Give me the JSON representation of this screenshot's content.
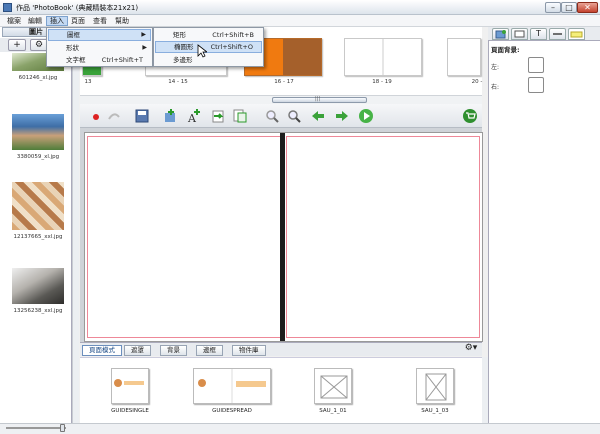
{
  "window": {
    "title": "作品 'PhotoBook' (典藏精裝本21x21)",
    "min_label": "–",
    "max_label": "□",
    "close_label": "✕"
  },
  "menubar": [
    "檔案",
    "編輯",
    "插入",
    "頁面",
    "查看",
    "幫助"
  ],
  "insert_menu": {
    "items": [
      {
        "label": "圖框",
        "shortcut": "",
        "submenu": true
      },
      {
        "label": "形狀",
        "shortcut": "",
        "submenu": true
      },
      {
        "label": "文字框",
        "shortcut": "Ctrl+Shift+T",
        "submenu": false
      }
    ]
  },
  "frame_submenu": {
    "items": [
      {
        "label": "矩形",
        "shortcut": "Ctrl+Shift+B"
      },
      {
        "label": "橢圓形",
        "shortcut": "Ctrl+Shift+O"
      },
      {
        "label": "多邊形",
        "shortcut": ""
      }
    ]
  },
  "left_panel": {
    "tab_label": "圖片",
    "add_label": "+",
    "gear_label": "⚙",
    "photos": [
      {
        "caption": "601246_xl.jpg",
        "color": "#7a8c5a"
      },
      {
        "caption": "3380059_xl.jpg",
        "color": "#3e6ea6"
      },
      {
        "caption": "12137665_xxl.jpg",
        "color": "#c98a55"
      },
      {
        "caption": "13256238_xxl.jpg",
        "color": "#6b6a66"
      }
    ]
  },
  "page_strip": {
    "pages": [
      {
        "caption": "13"
      },
      {
        "caption": "14 - 15"
      },
      {
        "caption": "16 - 17"
      },
      {
        "caption": "18 - 19"
      },
      {
        "caption": "20 -"
      }
    ],
    "scroll_grip": "|||"
  },
  "toolbar_icons": [
    "record-icon",
    "redo-icon",
    "save-icon",
    "add-image-icon",
    "add-text-icon",
    "export-icon",
    "export-copy-icon",
    "zoom-out-icon",
    "zoom-in-icon",
    "prev-icon",
    "next-icon",
    "play-icon",
    "cart-icon"
  ],
  "bottom_tabs": [
    "頁面模式",
    "遮罩",
    "背景",
    "邊框",
    "物件庫"
  ],
  "bottom_gear": "⚙▾",
  "templates": [
    {
      "caption": "GUIDESINGLE"
    },
    {
      "caption": "GUIDESPREAD"
    },
    {
      "caption": "SAU_1_01"
    },
    {
      "caption": "SAU_1_03"
    }
  ],
  "right_panel": {
    "tab_icons": [
      "layers-icon",
      "frame-icon",
      "text-icon",
      "line-icon",
      "page-icon"
    ],
    "tab_text_label": "T",
    "title": "頁面背景:",
    "left_label": "左:",
    "right_label": "右:"
  },
  "colors": {
    "accent": "#4a78b5",
    "orange_page": "#f07a10",
    "brown_page": "#a5602b",
    "green_icon": "#3aa23a",
    "red_guide": "#ee8898"
  }
}
